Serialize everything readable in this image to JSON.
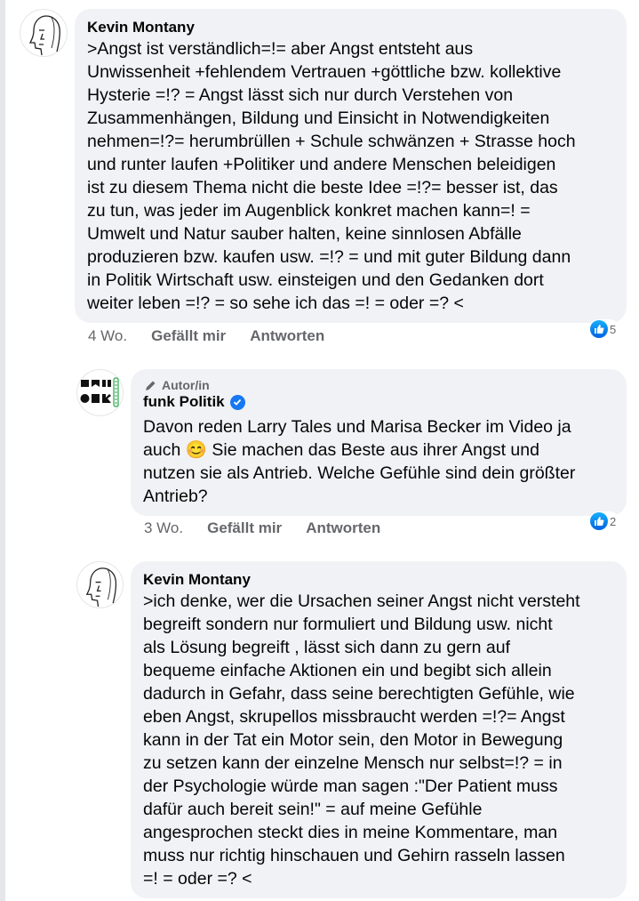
{
  "comments": [
    {
      "author": "Kevin Montany",
      "text": ">Angst ist verständlich=!= aber Angst entsteht aus\nUnwissenheit +fehlendem Vertrauen +göttliche bzw. kollektive\nHysterie =!? = Angst lässt sich nur durch Verstehen von\nZusammenhängen, Bildung und Einsicht in Notwendigkeiten\nnehmen=!?= herumbrüllen + Schule schwänzen + Strasse hoch\nund runter laufen +Politiker und andere Menschen beleidigen\nist zu diesem Thema nicht die beste  Idee =!?= besser ist, das\nzu tun, was jeder im Augenblick konkret machen kann=! =\nUmwelt und Natur sauber halten, keine sinnlosen Abfälle\nproduzieren bzw. kaufen usw. =!? = und mit guter Bildung dann\nin Politik Wirtschaft usw. einsteigen und den Gedanken dort\nweiter leben =!? = so sehe ich das =! = oder =? <",
      "time": "4 Wo.",
      "like_label": "Gefällt mir",
      "reply_label": "Antworten",
      "reaction_count": "5"
    },
    {
      "badge": "Autor/in",
      "author": "funk Politik",
      "text_before_emoji": "Davon reden Larry Tales und Marisa Becker im Video ja\nauch ",
      "emoji": "😊",
      "text_after_emoji": " Sie machen das Beste aus ihrer Angst und\nnutzen sie als Antrieb. Welche Gefühle sind dein größter\nAntrieb?",
      "time": "3 Wo.",
      "like_label": "Gefällt mir",
      "reply_label": "Antworten",
      "reaction_count": "2"
    },
    {
      "author": "Kevin Montany",
      "text": ">ich denke, wer die Ursachen seiner Angst nicht versteht\nbegreift sondern nur formuliert und  Bildung usw. nicht\nals Lösung begreift , lässt sich dann  zu gern auf\nbequeme einfache Aktionen ein und begibt sich allein\ndadurch  in Gefahr, dass seine berechtigten Gefühle, wie\neben Angst, skrupellos missbraucht werden =!?= Angst\nkann in der Tat ein Motor sein, den Motor in Bewegung\nzu setzen kann der einzelne  Mensch nur selbst=!? = in\nder Psychologie würde man sagen :\"Der Patient muss\ndafür auch bereit sein!\" = auf meine Gefühle\nangesprochen steckt dies in  meine Kommentare, man\nmuss nur richtig hinschauen und Gehirn rasseln lassen\n=! = oder =? <"
    }
  ],
  "colors": {
    "bubble": "#f0f2f5",
    "meta": "#65676b",
    "like_blue": "#1877f2"
  },
  "icons": [
    "face-sketch-avatar",
    "funk-logo-avatar",
    "pencil-icon",
    "verified-icon",
    "like-thumb-icon"
  ]
}
